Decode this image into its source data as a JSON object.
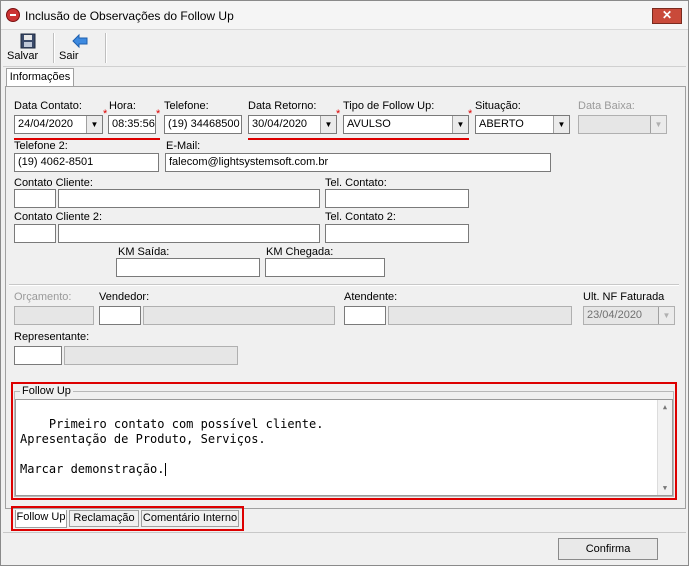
{
  "window": {
    "title": "Inclusão de Observações do Follow Up",
    "close_label": "✕"
  },
  "toolbar": {
    "save_label": "Salvar",
    "exit_label": "Sair"
  },
  "tab_top": "Informações",
  "form": {
    "data_contato": {
      "label": "Data Contato:",
      "value": "24/04/2020"
    },
    "hora": {
      "label": "Hora:",
      "value": "08:35:56"
    },
    "telefone": {
      "label": "Telefone:",
      "value": "(19) 34468500"
    },
    "data_retorno": {
      "label": "Data Retorno:",
      "value": "30/04/2020"
    },
    "tipo_follow_up": {
      "label": "Tipo de Follow Up:",
      "value": "AVULSO"
    },
    "situacao": {
      "label": "Situação:",
      "value": "ABERTO"
    },
    "data_baixa": {
      "label": "Data Baixa:",
      "value": ""
    },
    "telefone2": {
      "label": "Telefone 2:",
      "value": "(19) 4062-8501"
    },
    "email": {
      "label": "E-Mail:",
      "value": "falecom@lightsystemsoft.com.br"
    },
    "contato_cliente": {
      "label": "Contato Cliente:"
    },
    "tel_contato": {
      "label": "Tel. Contato:"
    },
    "contato_cliente2": {
      "label": "Contato Cliente 2:"
    },
    "tel_contato2": {
      "label": "Tel. Contato 2:"
    },
    "km_saida": {
      "label": "KM Saída:"
    },
    "km_chegada": {
      "label": "KM Chegada:"
    },
    "orcamento": {
      "label": "Orçamento:"
    },
    "vendedor": {
      "label": "Vendedor:"
    },
    "atendente": {
      "label": "Atendente:"
    },
    "ult_nf": {
      "label": "Ult. NF Faturada",
      "value": "23/04/2020"
    },
    "representante": {
      "label": "Representante:"
    },
    "required_mark": "*"
  },
  "follow_up": {
    "group_label": "Follow Up",
    "text": "Primeiro contato com possível cliente.\nApresentação de Produto, Serviços.\n\nMarcar demonstração."
  },
  "bottom_tabs": [
    "Follow Up",
    "Reclamação",
    "Comentário Interno"
  ],
  "confirm_label": "Confirma",
  "colors": {
    "highlight": "#dd0000",
    "window_bg": "#f0f0f0"
  }
}
